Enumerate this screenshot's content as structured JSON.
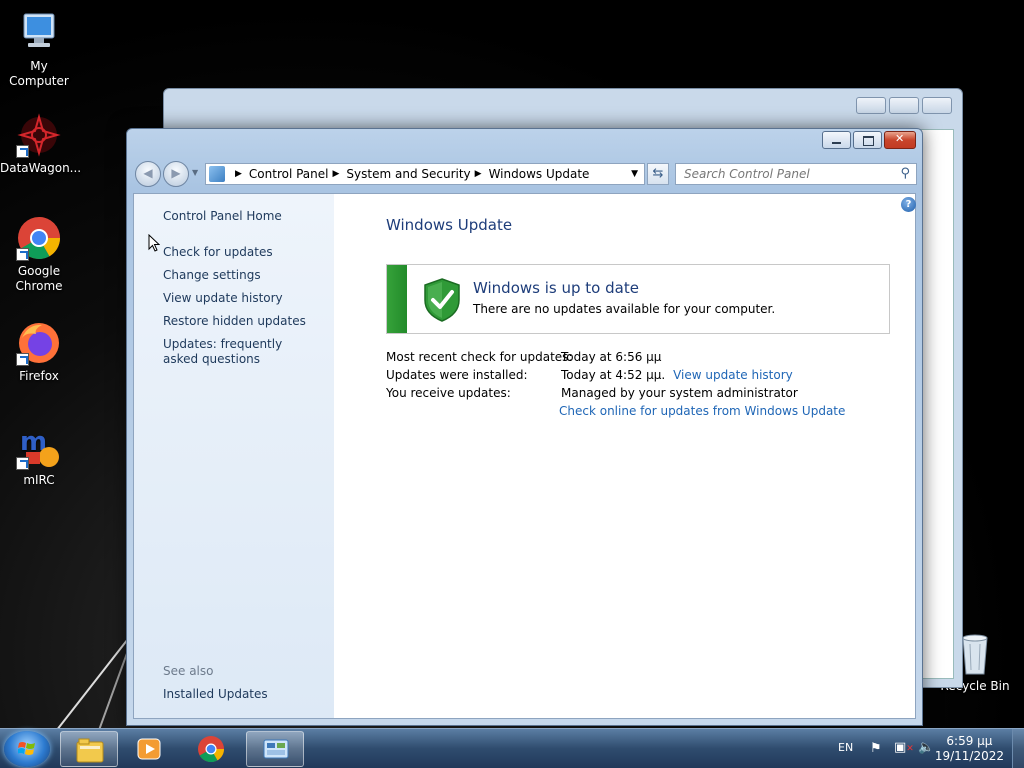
{
  "desktop": {
    "icons": [
      {
        "label": "My Computer",
        "icon": "computer-icon"
      },
      {
        "label": "DataWagon...",
        "icon": "datawagon-icon"
      },
      {
        "label": "Google Chrome",
        "icon": "chrome-icon"
      },
      {
        "label": "Firefox",
        "icon": "firefox-icon"
      },
      {
        "label": "mIRC",
        "icon": "mirc-icon"
      },
      {
        "label": "Recycle Bin",
        "icon": "recycle-bin-icon"
      }
    ]
  },
  "window": {
    "breadcrumb": [
      "Control Panel",
      "System and Security",
      "Windows Update"
    ],
    "search_placeholder": "Search Control Panel",
    "left_pane": {
      "home": "Control Panel Home",
      "links": [
        "Check for updates",
        "Change settings",
        "View update history",
        "Restore hidden updates",
        "Updates: frequently asked questions"
      ],
      "see_also_label": "See also",
      "see_also_links": [
        "Installed Updates"
      ]
    },
    "main": {
      "title": "Windows Update",
      "status": {
        "title": "Windows is up to date",
        "subtitle": "There are no updates available for your computer.",
        "color": "#2e9a34"
      },
      "info": [
        {
          "label": "Most recent check for updates:",
          "value": "Today at 6:56 μμ"
        },
        {
          "label": "Updates were installed:",
          "value": "Today at 4:52 μμ.",
          "link": "View update history"
        },
        {
          "label": "You receive updates:",
          "value": "Managed by your system administrator"
        }
      ],
      "online_link": "Check online for updates from Windows Update"
    }
  },
  "taskbar": {
    "language": "EN",
    "time": "6:59 μμ",
    "date": "19/11/2022",
    "apps": [
      "windows-explorer-icon",
      "media-player-icon",
      "chrome-icon",
      "control-panel-icon"
    ]
  }
}
